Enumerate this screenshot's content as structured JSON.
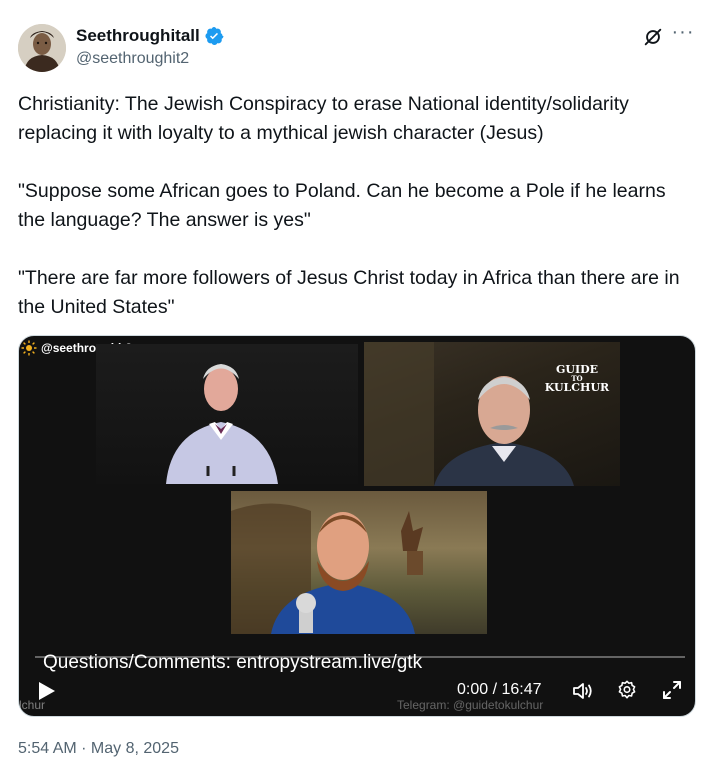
{
  "author": {
    "display_name": "Seethroughitall",
    "handle": "@seethroughit2",
    "verified": true
  },
  "icons": {
    "avatar": "avatar-portrait",
    "verified": "verified-badge-icon",
    "grok": "grok-icon",
    "more": "more-icon",
    "play": "play-icon",
    "volume": "volume-icon",
    "settings": "settings-gear-icon",
    "fullscreen": "fullscreen-icon"
  },
  "more_label": "···",
  "tweet": {
    "paragraphs": [
      "Christianity: The Jewish Conspiracy to erase National identity/solidarity replacing it with loyalty to a mythical jewish character (Jesus)",
      "\"Suppose some African goes to Poland. Can he become a Pole if he learns the language? The answer is yes\"",
      "\"There are far more followers of Jesus Christ today in Africa than there are in the United States\""
    ]
  },
  "video": {
    "watermark": "@seethroughit2",
    "logo": {
      "line1": "GUIDE",
      "line2": "TO",
      "line3": "KULCHUR"
    },
    "caption": "Questions/Comments: entropystream.live/gtk",
    "time": "0:00 / 16:47",
    "progress": 0,
    "corner_text": "lchur",
    "telegram_text": "Telegram: @guidetokulchur"
  },
  "timestamp": "5:54 AM · May 8, 2025",
  "colors": {
    "text_primary": "#0f1419",
    "text_secondary": "#536471",
    "verified_blue": "#1d9bf0",
    "video_bg": "#111111"
  }
}
